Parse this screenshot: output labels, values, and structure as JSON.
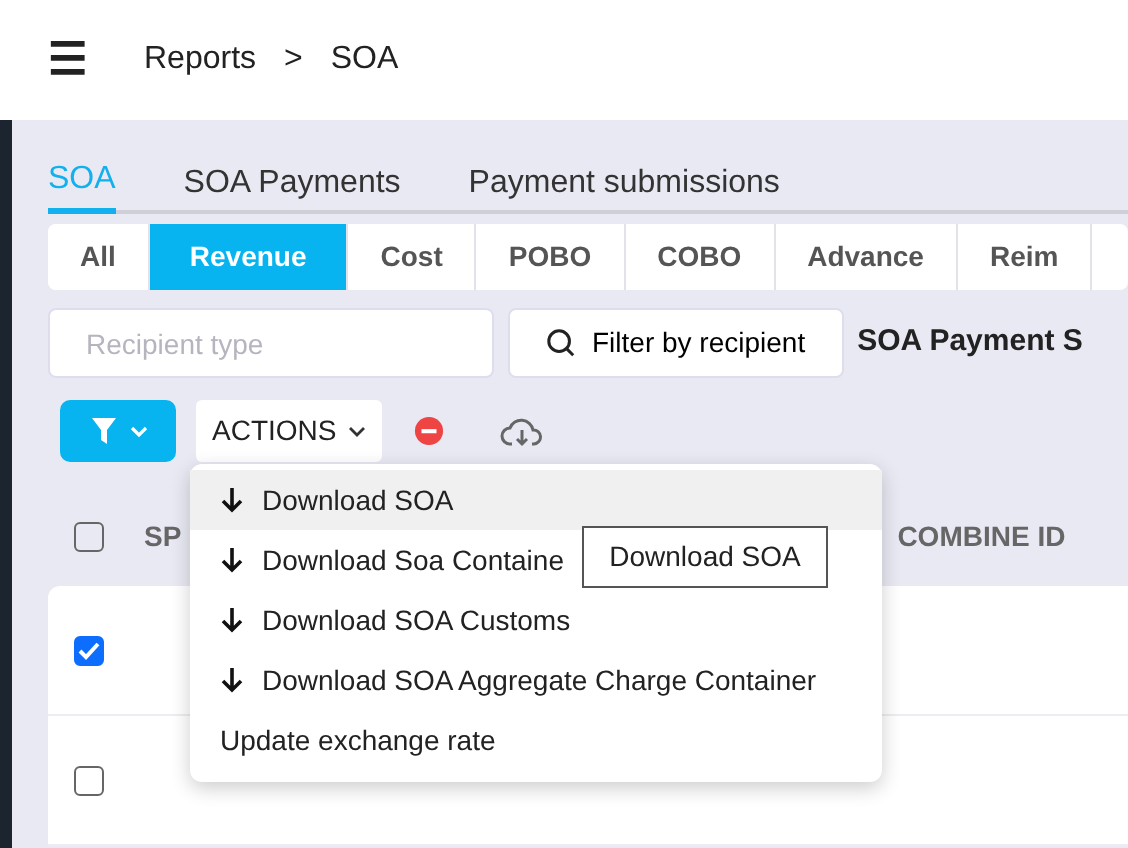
{
  "header": {
    "menu_icon": "☰",
    "breadcrumb": [
      "Reports",
      "SOA"
    ],
    "separator": ">"
  },
  "tabs": [
    {
      "label": "SOA",
      "selected": true
    },
    {
      "label": "SOA Payments",
      "selected": false
    },
    {
      "label": "Payment submissions",
      "selected": false
    }
  ],
  "segments": [
    {
      "label": "All",
      "selected": false
    },
    {
      "label": "Revenue",
      "selected": true
    },
    {
      "label": "Cost",
      "selected": false
    },
    {
      "label": "POBO",
      "selected": false
    },
    {
      "label": "COBO",
      "selected": false
    },
    {
      "label": "Advance",
      "selected": false
    },
    {
      "label": "Reim",
      "selected": false
    }
  ],
  "recipient_field": {
    "placeholder": "Recipient type"
  },
  "filter_button": "Filter by recipient",
  "section_title": "SOA Payment S",
  "actions_button": "ACTIONS",
  "table": {
    "columns": [
      "SP",
      "COMBINE ID"
    ],
    "select_all": {
      "checked": false
    },
    "rows": [
      {
        "checked": true
      },
      {
        "checked": false
      }
    ]
  },
  "menu": [
    {
      "label": "Download SOA",
      "kind": "download",
      "selected": true
    },
    {
      "label": "Download Soa Containe",
      "kind": "download",
      "selected": false
    },
    {
      "label": "Download SOA Customs",
      "kind": "download",
      "selected": false
    },
    {
      "label": "Download SOA Aggregate Charge Container",
      "kind": "download",
      "selected": false
    },
    {
      "label": "Update exchange rate",
      "kind": "plain",
      "selected": false
    }
  ],
  "tooltip": "Download SOA"
}
